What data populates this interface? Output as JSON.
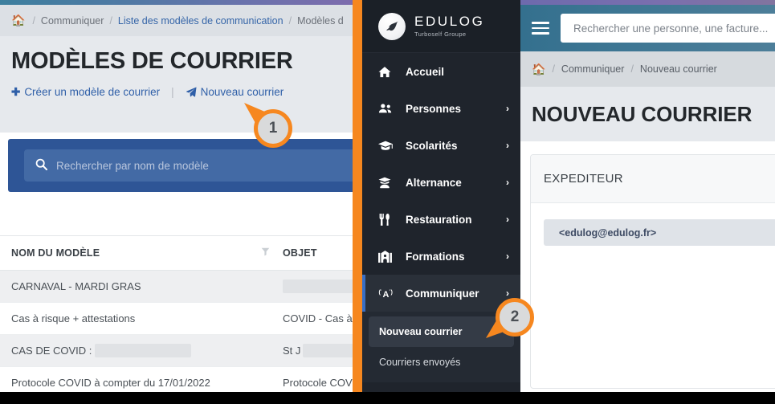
{
  "colors": {
    "orange": "#f6871f",
    "sidebar_bg": "#1f242c",
    "accent_blue": "#3a6fc4",
    "search_panel_blue": "#2e5596",
    "link_blue": "#3565a8"
  },
  "left_window": {
    "breadcrumb": {
      "home_icon": "home-icon",
      "items": [
        {
          "label": "Communiquer",
          "style": "muted"
        },
        {
          "label": "Liste des modèles de communication",
          "style": "link"
        },
        {
          "label": "Modèles d",
          "style": "muted"
        }
      ],
      "separator": "/"
    },
    "page_title": "MODÈLES DE COURRIER",
    "actions": {
      "create_icon": "plus-icon",
      "create_label": "Créer un modèle de courrier",
      "divider": "|",
      "new_icon": "paper-plane-icon",
      "new_label": "Nouveau courrier"
    },
    "search": {
      "icon": "search-icon",
      "placeholder": "Rechercher par nom de modèle",
      "value": ""
    },
    "table": {
      "columns": [
        {
          "key": "name",
          "label": "NOM DU MODÈLE",
          "filter_icon": "filter-icon"
        },
        {
          "key": "object",
          "label": "OBJET"
        }
      ],
      "rows": [
        {
          "name": "CARNAVAL - MARDI GRAS",
          "name_redacted_width": 0,
          "object": "",
          "object_redacted_width": 88
        },
        {
          "name": "Cas à risque + attestations",
          "name_redacted_width": 0,
          "object": "COVID - Cas à",
          "object_redacted_width": 0
        },
        {
          "name": "CAS DE COVID :",
          "name_redacted_width": 120,
          "object": "St J",
          "object_redacted_width": 64
        },
        {
          "name": "Protocole COVID à compter du 17/01/2022",
          "name_redacted_width": 0,
          "object": "Protocole COV",
          "object_redacted_width": 0
        }
      ]
    }
  },
  "sidebar": {
    "logo": {
      "icon": "bird-logo-icon",
      "word": "EDULOG",
      "subtitle": "Turboself Groupe"
    },
    "items": [
      {
        "label": "Accueil",
        "icon": "home-icon",
        "chevron": "",
        "active": false
      },
      {
        "label": "Personnes",
        "icon": "users-icon",
        "chevron": "›",
        "active": false
      },
      {
        "label": "Scolarités",
        "icon": "graduation-icon",
        "chevron": "›",
        "active": false
      },
      {
        "label": "Alternance",
        "icon": "student-icon",
        "chevron": "›",
        "active": false
      },
      {
        "label": "Restauration",
        "icon": "cutlery-icon",
        "chevron": "›",
        "active": false
      },
      {
        "label": "Formations",
        "icon": "building-icon",
        "chevron": "›",
        "active": false
      },
      {
        "label": "Communiquer",
        "icon": "megaphone-icon",
        "chevron": "›",
        "active": true
      }
    ],
    "submenu": [
      {
        "label": "Nouveau courrier",
        "selected": true
      },
      {
        "label": "Courriers envoyés",
        "selected": false
      }
    ]
  },
  "right_window": {
    "header": {
      "menu_icon": "hamburger-icon",
      "search_placeholder": "Rechercher une personne, une facture...",
      "search_value": ""
    },
    "breadcrumb": {
      "home_icon": "home-icon",
      "items": [
        {
          "label": "Communiquer"
        },
        {
          "label": "Nouveau courrier"
        }
      ],
      "separator": "/"
    },
    "page_title": "NOUVEAU COURRIER",
    "card": {
      "header": "EXPEDITEUR",
      "sender_chip": "<edulog@edulog.fr>"
    }
  },
  "callouts": [
    {
      "number": "1",
      "target": "nouveau-courrier-link"
    },
    {
      "number": "2",
      "target": "sidebar-submenu-nouveau-courrier"
    }
  ]
}
